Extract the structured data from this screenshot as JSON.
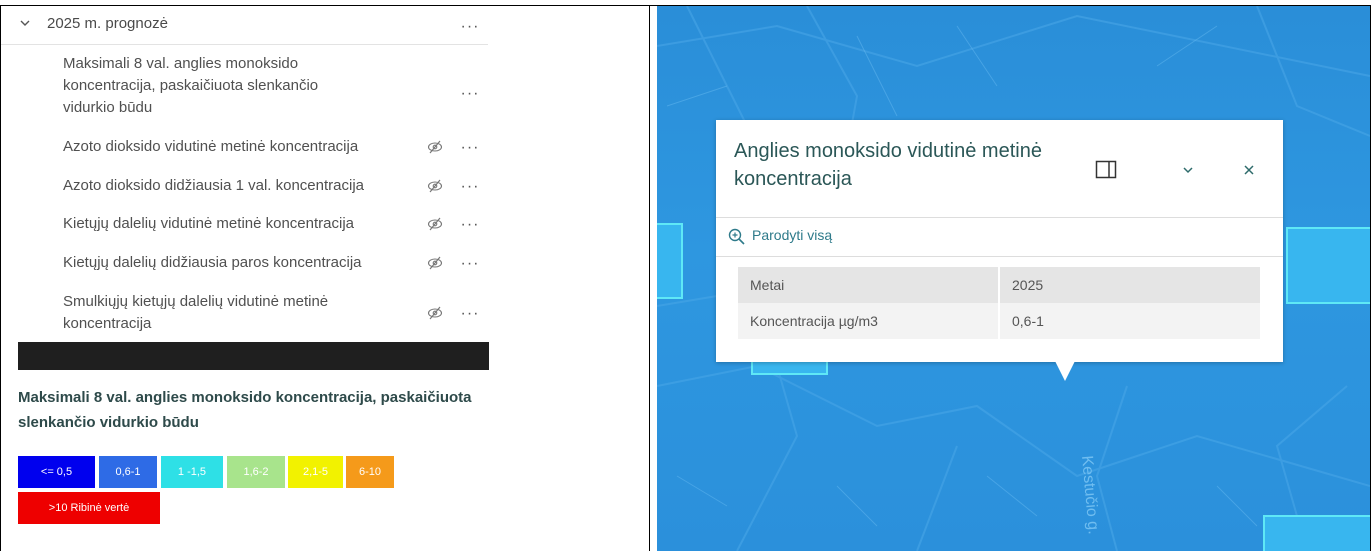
{
  "left_panel": {
    "group": {
      "title": "2025 m. prognozė",
      "more": "···"
    },
    "layers": [
      {
        "lines": [
          "Maksimali 8 val. anglies monoksido",
          "koncentracija, paskaičiuota slenkančio",
          "vidurkio būdu"
        ],
        "visible": true,
        "more": "···"
      },
      {
        "lines": [
          "Azoto dioksido vidutinė metinė koncentracija"
        ],
        "visible": false,
        "more": "···"
      },
      {
        "lines": [
          "Azoto dioksido didžiausia 1 val. koncentracija"
        ],
        "visible": false,
        "more": "···"
      },
      {
        "lines": [
          "Kietųjų dalelių vidutinė metinė koncentracija"
        ],
        "visible": false,
        "more": "···"
      },
      {
        "lines": [
          "Kietųjų dalelių didžiausia paros koncentracija"
        ],
        "visible": false,
        "more": "···"
      },
      {
        "lines": [
          "Smulkiųjų kietųjų dalelių vidutinė metinė",
          "koncentracija"
        ],
        "visible": false,
        "more": "···"
      }
    ],
    "legend": {
      "title_lines": [
        "Maksimali 8 val. anglies monoksido koncentracija, paskaičiuota",
        "slenkančio vidurkio būdu"
      ],
      "classes": [
        {
          "label": "<= 0,5",
          "color": "#0000ee"
        },
        {
          "label": "0,6-1",
          "color": "#2e6be6"
        },
        {
          "label": "1 -1,5",
          "color": "#2ee0e6"
        },
        {
          "label": "1,6-2",
          "color": "#a8e48c"
        },
        {
          "label": "2,1-5",
          "color": "#f2f200"
        },
        {
          "label": "6-10",
          "color": "#f59a1a"
        },
        {
          "label": ">10 Ribinė vertė",
          "color": "#ee0000"
        }
      ]
    }
  },
  "popup": {
    "title_lines": [
      "Anglies monoksido vidutinė metinė",
      "koncentracija"
    ],
    "zoom_label": "Parodyti visą",
    "attributes": [
      {
        "key": "Metai",
        "value": "2025"
      },
      {
        "key": "Koncentracija µg/m3",
        "value": "0,6-1"
      }
    ]
  },
  "map": {
    "street_label": "Kestučio g."
  }
}
